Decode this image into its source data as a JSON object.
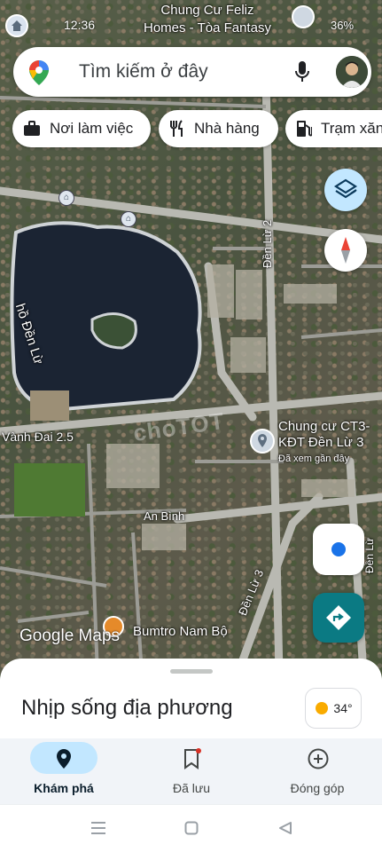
{
  "status_bar": {
    "time": "12:36",
    "battery": "36%"
  },
  "search": {
    "placeholder": "Tìm kiếm ở đây"
  },
  "chips": [
    {
      "label": "Nơi làm việc",
      "icon": "briefcase-icon"
    },
    {
      "label": "Nhà hàng",
      "icon": "restaurant-icon"
    },
    {
      "label": "Trạm xăng",
      "icon": "gas-station-icon"
    }
  ],
  "map": {
    "lake_label": "hồ Đền Lừ",
    "road_vanh_dai": "Vành Đai 2.5",
    "road_den_lu_2": "Đền Lừ 2",
    "road_den_lu_3": "Đền Lừ 3",
    "road_an_binh": "An Bình",
    "road_side": "Đền Lừ",
    "poi_ct3": "Chung cư CT3-",
    "poi_ct3_line2": "KĐT Đền Lừ 3",
    "poi_ct3_sub": "Đã xem gần đây",
    "poi_feliz_line1": "Chung Cư Feliz",
    "poi_feliz_line2": "Homes - Tòa Fantasy",
    "poi_bumtro": "Bumtro Nam Bộ",
    "watermark": "choTOT",
    "logo_text": "Google Maps"
  },
  "sheet": {
    "title": "Nhịp sống địa phương",
    "weather_temp": "34°"
  },
  "nav": [
    {
      "label": "Khám phá",
      "icon": "explore-pin-icon",
      "active": true
    },
    {
      "label": "Đã lưu",
      "icon": "bookmark-icon",
      "active": false
    },
    {
      "label": "Đóng góp",
      "icon": "add-circle-icon",
      "active": false
    }
  ],
  "colors": {
    "accent": "#c2e7ff",
    "directions": "#0b7a83",
    "location_dot": "#1a73e8"
  }
}
